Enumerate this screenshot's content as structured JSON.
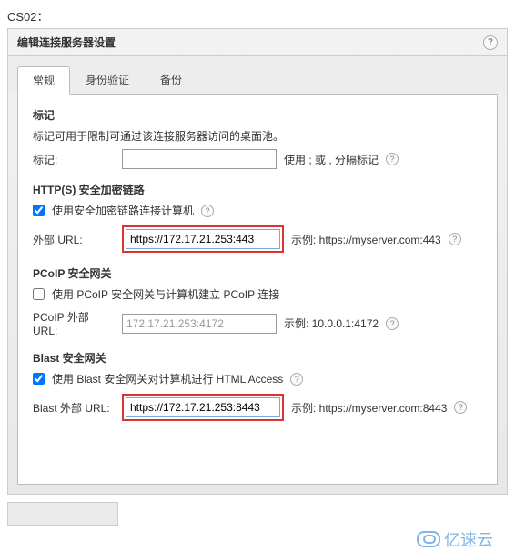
{
  "page_label": "CS02：",
  "dialog_title": "编辑连接服务器设置",
  "tabs": {
    "general": "常规",
    "auth": "身份验证",
    "backup": "备份"
  },
  "tags_section": {
    "title": "标记",
    "desc": "标记可用于限制可通过该连接服务器访问的桌面池。",
    "label": "标记:",
    "value": "",
    "hint": "使用 ; 或 , 分隔标记"
  },
  "https_section": {
    "title": "HTTP(S) 安全加密链路",
    "checkbox_label": "使用安全加密链路连接计算机",
    "checkbox_checked": true,
    "url_label": "外部 URL:",
    "url_value": "https://172.17.21.253:443",
    "example": "示例: https://myserver.com:443"
  },
  "pcoip_section": {
    "title": "PCoIP 安全网关",
    "checkbox_label": "使用 PCoIP 安全网关与计算机建立 PCoIP 连接",
    "checkbox_checked": false,
    "url_label": "PCoIP 外部 URL:",
    "url_value": "172.17.21.253:4172",
    "example": "示例: 10.0.0.1:4172"
  },
  "blast_section": {
    "title": "Blast 安全网关",
    "checkbox_label": "使用 Blast 安全网关对计算机进行 HTML Access",
    "checkbox_checked": true,
    "url_label": "Blast 外部 URL:",
    "url_value": "https://172.17.21.253:8443",
    "example": "示例: https://myserver.com:8443"
  },
  "watermark": "亿速云"
}
